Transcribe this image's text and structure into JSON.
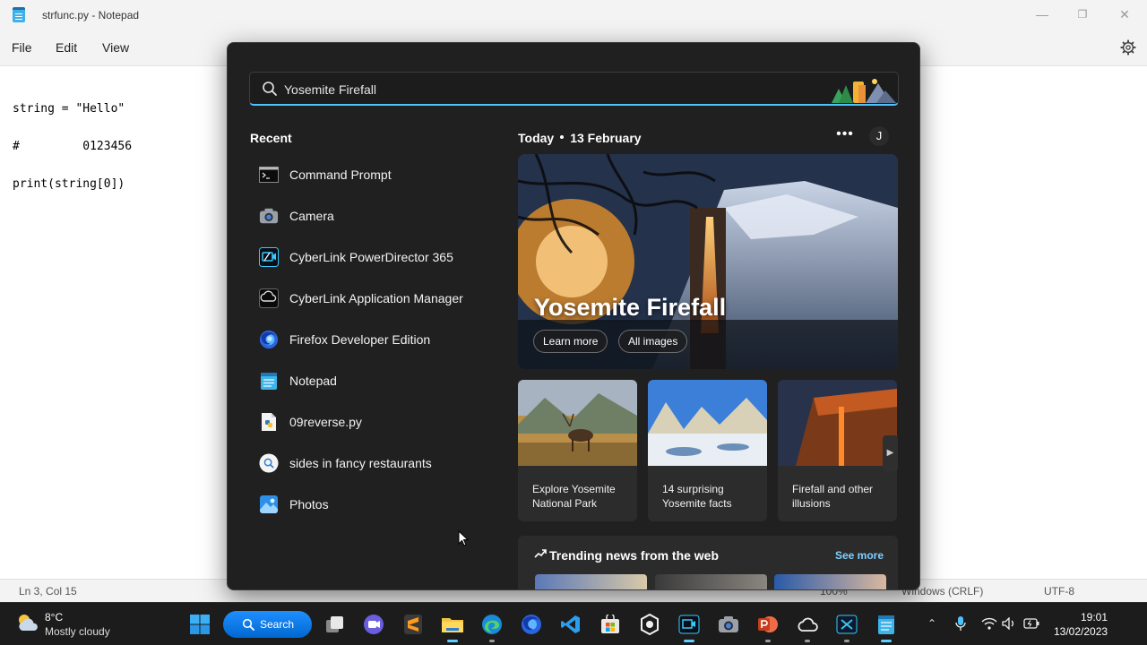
{
  "notepad": {
    "title": "strfunc.py - Notepad",
    "menu": [
      "File",
      "Edit",
      "View"
    ],
    "code_lines": [
      "string = \"Hello\"",
      "#         0123456",
      "print(string[0])"
    ],
    "status": {
      "position": "Ln 3, Col 15",
      "zoom": "100%",
      "line_ending": "Windows (CRLF)",
      "encoding": "UTF-8"
    }
  },
  "search": {
    "query": "Yosemite Firefall"
  },
  "recent": {
    "title": "Recent",
    "items": [
      {
        "label": "Command Prompt",
        "icon": "command-prompt-icon"
      },
      {
        "label": "Camera",
        "icon": "camera-icon"
      },
      {
        "label": "CyberLink PowerDirector 365",
        "icon": "powerdirector-icon"
      },
      {
        "label": "CyberLink Application Manager",
        "icon": "cyberlink-manager-icon"
      },
      {
        "label": "Firefox Developer Edition",
        "icon": "firefox-icon"
      },
      {
        "label": "Notepad",
        "icon": "notepad-icon"
      },
      {
        "label": "09reverse.py",
        "icon": "python-file-icon"
      },
      {
        "label": "sides in fancy restaurants",
        "icon": "web-search-icon"
      },
      {
        "label": "Photos",
        "icon": "photos-icon"
      }
    ]
  },
  "today": {
    "label": "Today",
    "date": "13 February",
    "more": "•••",
    "avatar_initial": "J"
  },
  "hero": {
    "title": "Yosemite Firefall",
    "learn_more": "Learn more",
    "all_images": "All images"
  },
  "cards": [
    {
      "label": "Explore Yosemite National Park"
    },
    {
      "label": "14 surprising Yosemite facts"
    },
    {
      "label": "Firefall and other illusions"
    }
  ],
  "trending": {
    "title": "Trending news from the web",
    "see_more": "See more"
  },
  "taskbar": {
    "weather_temp": "8°C",
    "weather_desc": "Mostly cloudy",
    "search_label": "Search",
    "time": "19:01",
    "date": "13/02/2023"
  },
  "colors": {
    "accent": "#4cc2ff",
    "panel_bg": "#202020",
    "taskbar_bg": "#1c1c1c",
    "search_button": "#0078d4"
  }
}
